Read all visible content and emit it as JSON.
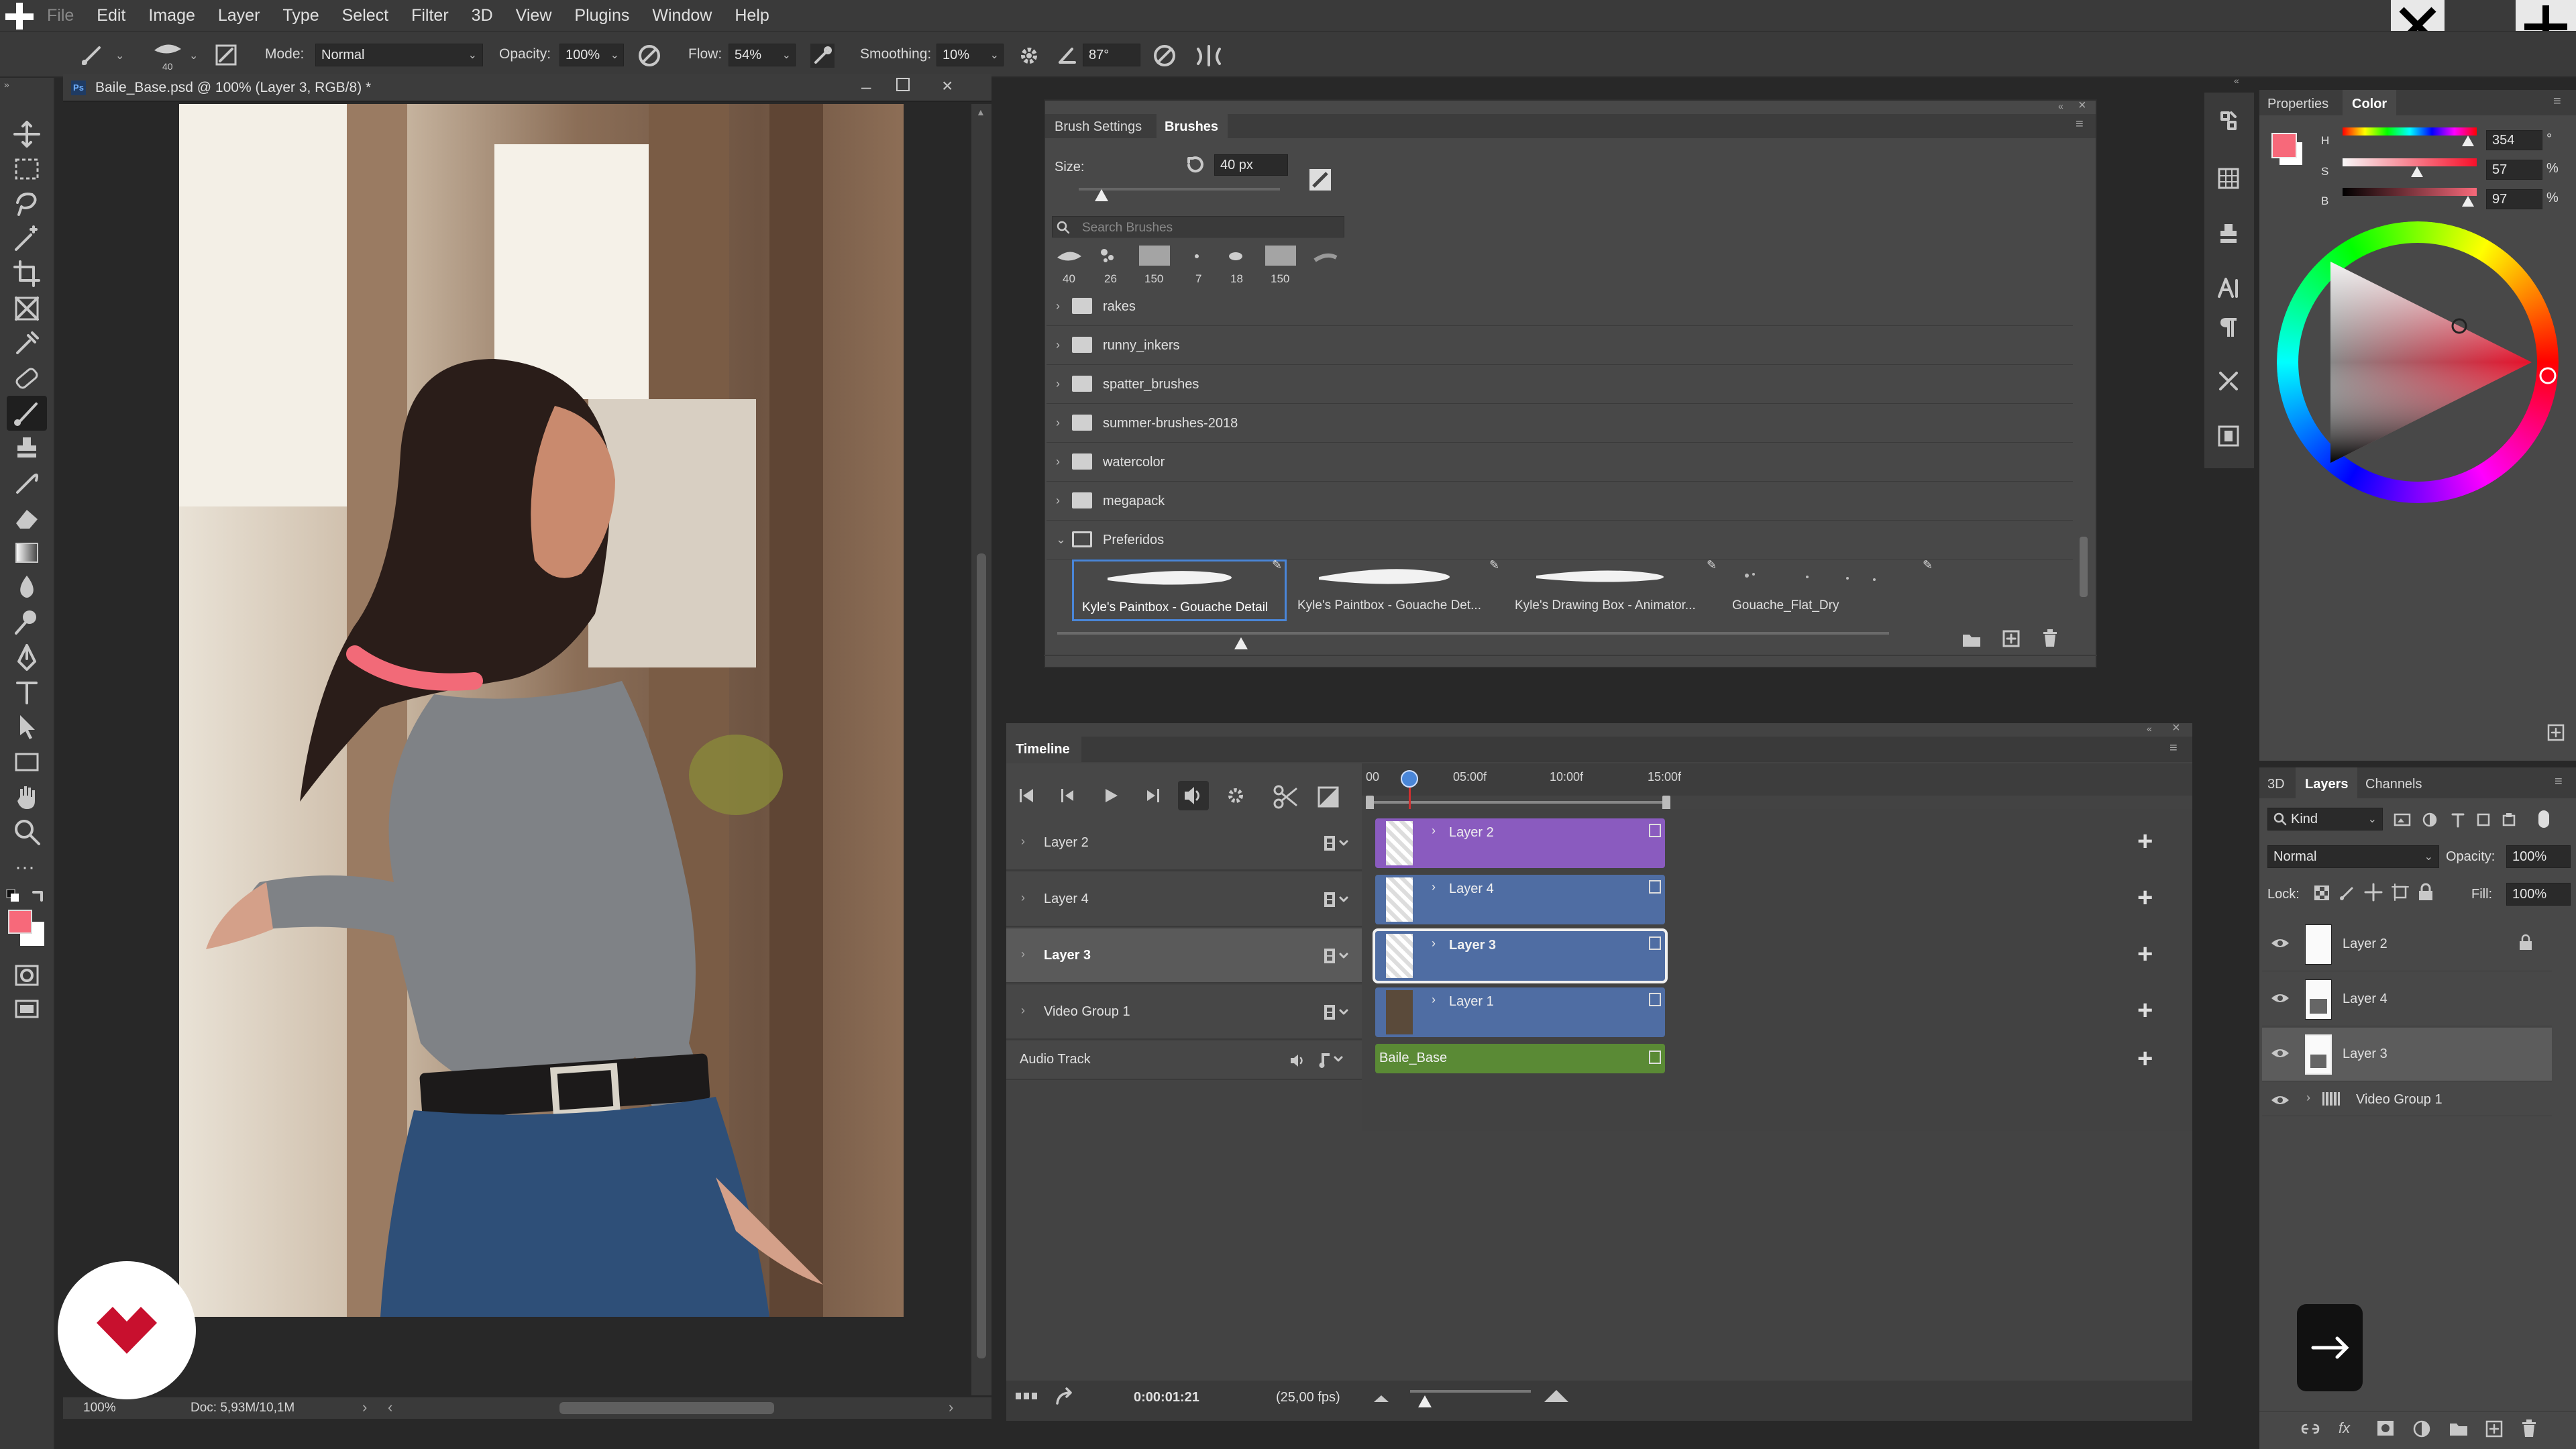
{
  "menu": {
    "items": [
      "File",
      "Edit",
      "Image",
      "Layer",
      "Type",
      "Select",
      "Filter",
      "3D",
      "View",
      "Plugins",
      "Window",
      "Help"
    ]
  },
  "options": {
    "brush_size": "40",
    "mode_label": "Mode:",
    "mode_value": "Normal",
    "opacity_label": "Opacity:",
    "opacity_value": "100%",
    "flow_label": "Flow:",
    "flow_value": "54%",
    "smoothing_label": "Smoothing:",
    "smoothing_value": "10%",
    "angle_value": "87°"
  },
  "document": {
    "tab_title": "Baile_Base.psd @ 100% (Layer 3, RGB/8) *",
    "zoom": "100%",
    "doc_size": "Doc: 5,93M/10,1M"
  },
  "brush_panel": {
    "tabs": [
      "Brush Settings",
      "Brushes"
    ],
    "active_tab": "Brushes",
    "size_label": "Size:",
    "size_value": "40 px",
    "search_placeholder": "Search Brushes",
    "recent_sizes": [
      "40",
      "26",
      "150",
      "7",
      "18",
      "150"
    ],
    "folders": [
      "rakes",
      "runny_inkers",
      "spatter_brushes",
      "summer-brushes-2018",
      "watercolor",
      "megapack",
      "Preferidos"
    ],
    "preset_brushes": [
      "Kyle's Paintbox - Gouache Detail",
      "Kyle's Paintbox - Gouache Det...",
      "Kyle's Drawing Box - Animator...",
      "Gouache_Flat_Dry"
    ],
    "selected_preset": "Kyle's Paintbox - Gouache Detail",
    "preview_size_fraction": 0.28
  },
  "timeline": {
    "title": "Timeline",
    "ruler": [
      "00",
      "05:00f",
      "10:00f",
      "15:00f"
    ],
    "tracks": [
      {
        "name": "Layer 2",
        "clip": "Layer 2",
        "color": "#8a5bbf"
      },
      {
        "name": "Layer 4",
        "clip": "Layer 4",
        "color": "#4f6da3"
      },
      {
        "name": "Layer 3",
        "clip": "Layer 3",
        "color": "#4f6da3"
      },
      {
        "name": "Video Group 1",
        "clip": "Layer 1",
        "color": "#4f6da3"
      }
    ],
    "audio_track": "Audio Track",
    "audio_clip": "Baile_Base",
    "current_time": "0:00:01:21",
    "fps": "(25,00 fps)",
    "zoom_fraction": 0.35
  },
  "properties": {
    "tabs": [
      "Properties",
      "Color"
    ],
    "active_tab": "Color",
    "h_label": "H",
    "h_value": "354",
    "h_unit": "°",
    "s_label": "S",
    "s_value": "57",
    "s_unit": "%",
    "b_label": "B",
    "b_value": "97",
    "b_unit": "%",
    "foreground_color": "#f7697a"
  },
  "layers_panel": {
    "tabs": [
      "3D",
      "Layers",
      "Channels"
    ],
    "active_tab": "Layers",
    "kind_label": "Kind",
    "blend_mode": "Normal",
    "opacity_label": "Opacity:",
    "opacity_value": "100%",
    "lock_label": "Lock:",
    "fill_label": "Fill:",
    "fill_value": "100%",
    "layers": [
      "Layer 2",
      "Layer 4",
      "Layer 3",
      "Video Group 1"
    ]
  },
  "colors": {
    "accent_blue": "#4a86d8",
    "stroke_pink": "#f26a78",
    "audio_green": "#5a8a35",
    "video_purple": "#8a5bbf"
  }
}
